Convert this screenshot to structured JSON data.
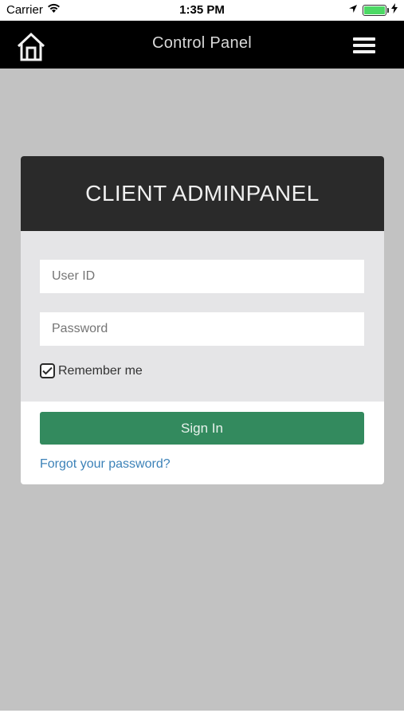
{
  "status_bar": {
    "carrier": "Carrier",
    "time": "1:35 PM",
    "battery_level": 1.0,
    "icons": [
      "wifi-icon",
      "location-arrow-icon",
      "battery-icon",
      "charging-icon"
    ]
  },
  "nav": {
    "title": "Control Panel",
    "home_icon": "home-icon",
    "menu_icon": "hamburger-menu-icon"
  },
  "login": {
    "header": "CLIENT ADMINPANEL",
    "user_id_placeholder": "User ID",
    "password_placeholder": "Password",
    "remember_label": "Remember me",
    "remember_checked": true,
    "signin_label": "Sign In",
    "forgot_label": "Forgot your password?"
  },
  "colors": {
    "nav_bg": "#000000",
    "page_bg": "#c2c2c2",
    "card_header_bg": "#2a2a2a",
    "form_bg": "#e5e5e7",
    "signin_bg": "#338a5e",
    "link": "#3c82b8",
    "battery": "#4cd964"
  }
}
